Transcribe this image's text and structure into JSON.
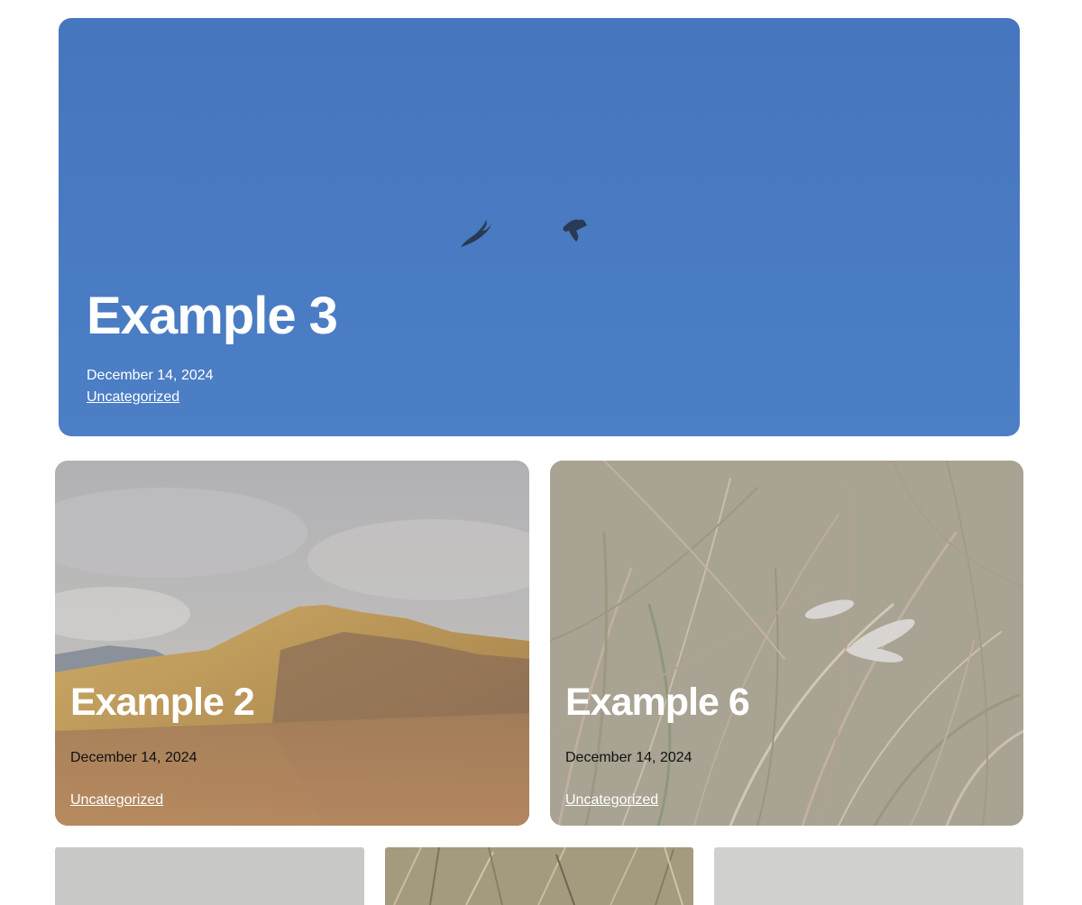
{
  "posts": [
    {
      "title": "Example 3",
      "date": "December 14, 2024",
      "category": "Uncategorized"
    },
    {
      "title": "Example 2",
      "date": "December 14, 2024",
      "category": "Uncategorized"
    },
    {
      "title": "Example 6",
      "date": "December 14, 2024",
      "category": "Uncategorized"
    }
  ],
  "colors": {
    "hero_sky": "#4a7cc2",
    "overlay": "rgba(255,255,255,0.22)",
    "text_light": "#ffffff",
    "text_dark": "#111111"
  }
}
